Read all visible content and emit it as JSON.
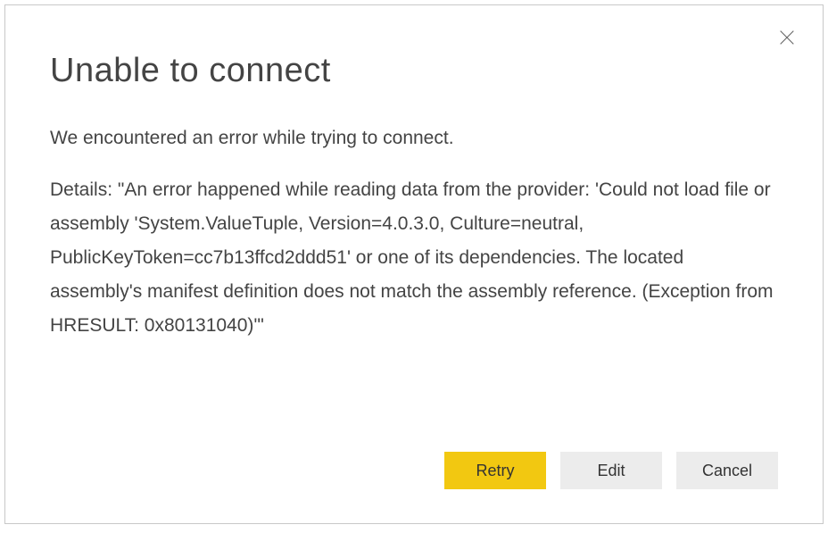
{
  "dialog": {
    "title": "Unable to connect",
    "message": "We encountered an error while trying to connect.",
    "details": "Details: \"An error happened while reading data from the provider: 'Could not load file or assembly 'System.ValueTuple, Version=4.0.3.0, Culture=neutral, PublicKeyToken=cc7b13ffcd2ddd51' or one of its dependencies. The located assembly's manifest definition does not match the assembly reference. (Exception from HRESULT: 0x80131040)'\""
  },
  "buttons": {
    "retry_label": "Retry",
    "edit_label": "Edit",
    "cancel_label": "Cancel"
  },
  "colors": {
    "primary": "#f2c811",
    "secondary": "#ececec",
    "text": "#444444",
    "border": "#c8c8c8"
  }
}
